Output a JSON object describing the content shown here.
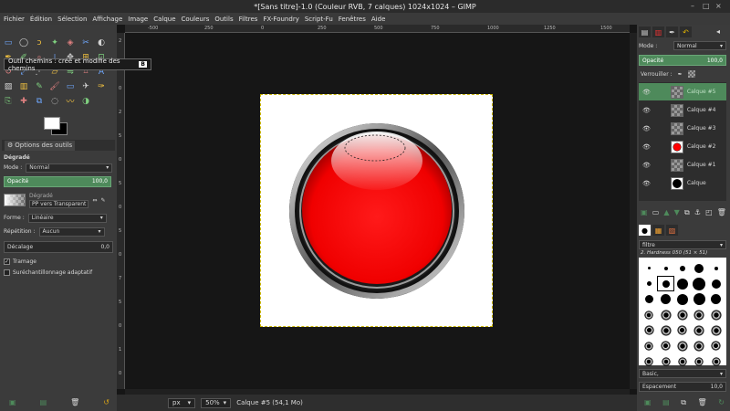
{
  "window": {
    "title": "*[Sans titre]-1.0 (Couleur RVB, 7 calques) 1024x1024 – GIMP",
    "controls": [
      "–",
      "□",
      "×"
    ]
  },
  "menu": [
    "Fichier",
    "Édition",
    "Sélection",
    "Affichage",
    "Image",
    "Calque",
    "Couleurs",
    "Outils",
    "Filtres",
    "FX-Foundry",
    "Script-Fu",
    "Fenêtres",
    "Aide"
  ],
  "toolbox": {
    "tooltip": "Outil chemins : crée et modifie des chemins",
    "tooltip_key": "B",
    "tool_icons": [
      "rect-select-icon",
      "ellipse-select-icon",
      "lasso-icon",
      "fuzzy-select-icon",
      "color-select-icon",
      "scissors-icon",
      "foreground-select-icon",
      "paths-icon",
      "color-picker-icon",
      "zoom-icon",
      "measure-icon",
      "move-icon",
      "align-icon",
      "crop-icon",
      "rotate-icon",
      "scale-icon",
      "shear-icon",
      "perspective-icon",
      "flip-icon",
      "cage-icon",
      "text-icon",
      "bucket-fill-icon",
      "blend-icon",
      "pencil-icon",
      "paintbrush-icon",
      "eraser-icon",
      "airbrush-icon",
      "ink-icon",
      "clone-icon",
      "heal-icon",
      "perspective-clone-icon",
      "blur-icon",
      "smudge-icon",
      "dodge-icon",
      "unused"
    ],
    "tool_glyphs": [
      "▭",
      "◯",
      "ↄ",
      "✦",
      "◈",
      "✂",
      "◐",
      "✒",
      "✐",
      "⌕",
      "⟂",
      "✥",
      "⊞",
      "⊡",
      "↻",
      "⤢",
      "⋰",
      "▱",
      "⇋",
      "⌗",
      "A",
      "▨",
      "▥",
      "✎",
      "🖌",
      "▭",
      "✈",
      "✑",
      "⎘",
      "✚",
      "⧉",
      "◌",
      "〰",
      "◑",
      ""
    ]
  },
  "tool_options": {
    "tab_label": "Options des outils",
    "tool_name": "Dégradé",
    "mode_label": "Mode :",
    "mode_value": "Normal",
    "opacity_label": "Opacité",
    "opacity_value": "100,0",
    "gradient_label": "Dégradé",
    "gradient_value": "PP vers Transparent",
    "shape_label": "Forme :",
    "shape_value": "Linéaire",
    "repeat_label": "Répétition :",
    "repeat_value": "Aucun",
    "offset_label": "Décalage",
    "offset_value": "0,0",
    "dithering_label": "Tramage",
    "dithering_checked": true,
    "supersampling_label": "Suréchantillonnage adaptatif",
    "supersampling_checked": false
  },
  "rulers": {
    "h_ticks": [
      "-500",
      "250",
      "0",
      "250",
      "500",
      "750",
      "1000",
      "1250",
      "1500"
    ],
    "v_ticks": [
      "2",
      "5",
      "0",
      "2",
      "5",
      "0",
      "5",
      "0",
      "5",
      "0",
      "7",
      "5",
      "0",
      "1",
      "0"
    ]
  },
  "status": {
    "unit": "px",
    "zoom": "50%",
    "message": "Calque #5 (54,1 Mo)"
  },
  "layers_panel": {
    "mode_label": "Mode :",
    "mode_value": "Normal",
    "opacity_label": "Opacité",
    "opacity_value": "100,0",
    "lock_label": "Verrouiller :",
    "layers": [
      {
        "name": "Calque #5",
        "selected": true,
        "thumb": "checker"
      },
      {
        "name": "Calque #4",
        "selected": false,
        "thumb": "checker"
      },
      {
        "name": "Calque #3",
        "selected": false,
        "thumb": "checker"
      },
      {
        "name": "Calque #2",
        "selected": false,
        "thumb": "red"
      },
      {
        "name": "Calque #1",
        "selected": false,
        "thumb": "checker"
      },
      {
        "name": "Calque",
        "selected": false,
        "thumb": "black"
      }
    ]
  },
  "brushes": {
    "filter": "filtre",
    "selected": "2. Hardness 050 (51 × 51)",
    "preset": "Basic,",
    "spacing_label": "Espacement",
    "spacing_value": "10,0"
  },
  "colors": {
    "accent_green": "#4e8a5b",
    "ball_red": "#ff0000",
    "canvas_border": "#c8b400"
  }
}
